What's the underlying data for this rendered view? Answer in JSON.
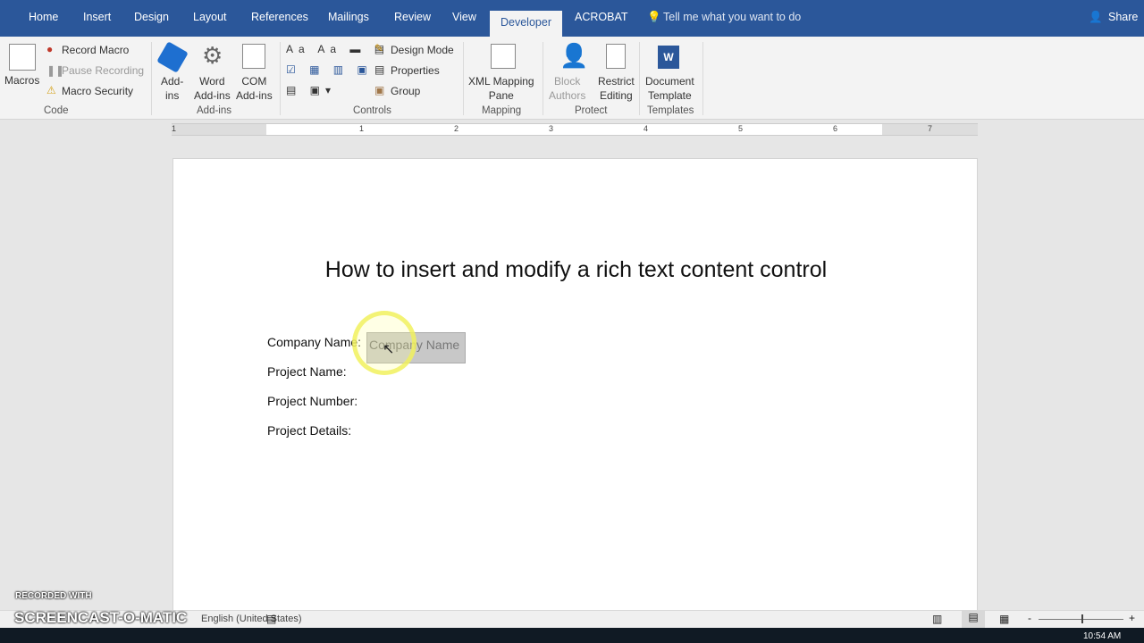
{
  "tabs": [
    "Home",
    "Insert",
    "Design",
    "Layout",
    "References",
    "Mailings",
    "Review",
    "View",
    "Developer",
    "ACROBAT"
  ],
  "active_tab": "Developer",
  "tell_me": "Tell me what you want to do",
  "share": "Share",
  "ribbon": {
    "code": {
      "macros": "Macros",
      "record": "Record Macro",
      "pause": "Pause Recording",
      "security": "Macro Security",
      "group": "Code"
    },
    "addins": {
      "addins": "Add-\nins",
      "word": "Word\nAdd-ins",
      "com": "COM\nAdd-ins",
      "group": "Add-ins"
    },
    "controls": {
      "design": "Design Mode",
      "properties": "Properties",
      "group_btn": "Group",
      "group": "Controls"
    },
    "mapping": {
      "xml": "XML Mapping\nPane",
      "group": "Mapping"
    },
    "protect": {
      "block": "Block\nAuthors",
      "restrict": "Restrict\nEditing",
      "group": "Protect"
    },
    "templates": {
      "doc": "Document\nTemplate",
      "group": "Templates"
    }
  },
  "ruler": [
    "1",
    "1",
    "2",
    "3",
    "4",
    "5",
    "6",
    "7"
  ],
  "doc": {
    "title": "How to insert and modify a rich text content control",
    "labels": [
      "Company Name:",
      "Project Name:",
      "Project Number:",
      "Project Details:"
    ],
    "control_placeholder": "Company Name"
  },
  "status": {
    "language": "English (United States)"
  },
  "watermark": {
    "line1": "RECORDED WITH",
    "line2": "SCREENCAST-O-MATIC"
  },
  "clock": "10:54 AM",
  "colors": {
    "accent": "#2b579a"
  }
}
